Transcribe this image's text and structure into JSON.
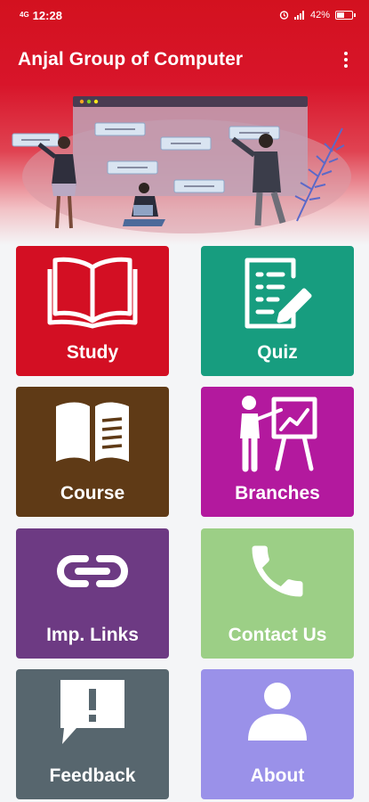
{
  "status_bar": {
    "network": "4G",
    "time": "12:28",
    "battery_text": "42%",
    "battery_level": 0.42
  },
  "app_bar": {
    "title": "Anjal Group of Computer",
    "menu_icon": "more-vert-icon"
  },
  "colors": {
    "primary": "#d3111f",
    "study": "#d30f23",
    "quiz": "#179d7f",
    "course": "#5f3a16",
    "branches": "#b3199e",
    "imp_links": "#6d3a83",
    "contact": "#9ccf86",
    "feedback": "#57666e",
    "about": "#9a91e9"
  },
  "tiles": [
    {
      "label": "Study",
      "icon": "open-book-icon"
    },
    {
      "label": "Quiz",
      "icon": "quiz-document-icon"
    },
    {
      "label": "Course",
      "icon": "book-icon"
    },
    {
      "label": "Branches",
      "icon": "presentation-icon"
    },
    {
      "label": "Imp. Links",
      "icon": "link-icon"
    },
    {
      "label": "Contact Us",
      "icon": "phone-icon"
    },
    {
      "label": "Feedback",
      "icon": "feedback-icon"
    },
    {
      "label": "About",
      "icon": "person-icon"
    }
  ]
}
